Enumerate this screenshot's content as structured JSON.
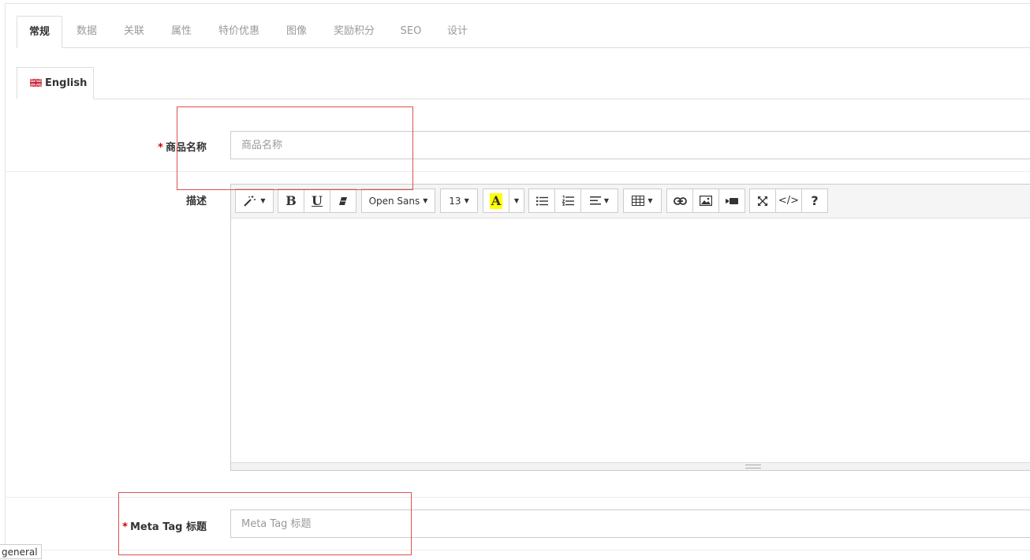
{
  "tabs": [
    {
      "label": "常规",
      "active": true
    },
    {
      "label": "数据"
    },
    {
      "label": "关联"
    },
    {
      "label": "属性"
    },
    {
      "label": "特价优惠"
    },
    {
      "label": "图像"
    },
    {
      "label": "奖励积分"
    },
    {
      "label": "SEO"
    },
    {
      "label": "设计"
    }
  ],
  "language_tab": {
    "label": "English",
    "icon": "uk-flag-icon"
  },
  "fields": {
    "product_name": {
      "required_mark": "*",
      "label": "商品名称",
      "placeholder": "商品名称",
      "value": ""
    },
    "description": {
      "label": "描述"
    },
    "meta_title": {
      "required_mark": "*",
      "label": "Meta Tag 标题",
      "placeholder": "Meta Tag 标题",
      "value": ""
    }
  },
  "editor_toolbar": {
    "font_family": "Open Sans",
    "font_size": "13",
    "highlight_letter": "A",
    "highlight_color": "#ffff00",
    "bold_glyph": "B",
    "underline_glyph": "U",
    "codeview_glyph": "</>",
    "help_glyph": "?"
  },
  "annotation_color": "#d9534f",
  "status_bar": {
    "text": "general"
  }
}
